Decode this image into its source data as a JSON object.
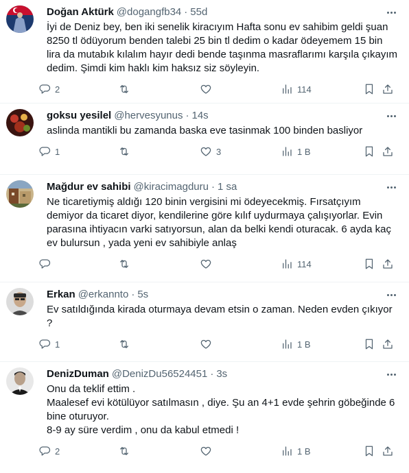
{
  "tweets": [
    {
      "name": "Doğan Aktürk",
      "handle": "@dogangfb34",
      "time": "55d",
      "text": "İyi de Deniz bey, ben iki senelik kiracıyım Hafta sonu ev sahibim geldi şuan 8250 tl ödüyorum benden talebi 25 bin tl dedim o kadar ödeyemem 15 bin lira da mutabık kılalım hayır dedi bende taşınma masraflarımı karşıla çıkayım dedim. Şimdi kim haklı kim haksız siz söyleyin.",
      "replies": "2",
      "retweets": "",
      "likes": "",
      "views": "114",
      "avatar_color": "#1d3a6e"
    },
    {
      "name": "goksu yesilel",
      "handle": "@hervesyunus",
      "time": "14s",
      "text": "aslinda mantikli bu zamanda baska eve tasinmak 100 binden basliyor",
      "replies": "1",
      "retweets": "",
      "likes": "3",
      "views": "1 B",
      "avatar_color": "#8a2a1c"
    },
    {
      "name": "Mağdur ev sahibi",
      "handle": "@kiracimagduru",
      "time": "1 sa",
      "text": "Ne ticaretiymiş aldığı 120 binin vergisini mi ödeyecekmiş. Fırsatçıyım demiyor da ticaret diyor, kendilerine göre kılıf uydurmaya çalışıyorlar. Evin parasına ihtiyacın varki satıyorsun, alan da belki kendi oturacak. 6 ayda kaç ev bulursun , yada yeni ev sahibiyle anlaş",
      "replies": "",
      "retweets": "",
      "likes": "",
      "views": "114",
      "avatar_color": "#6e5a3a"
    },
    {
      "name": "Erkan",
      "handle": "@erkannto",
      "time": "5s",
      "text": "Ev satıldığında kirada oturmaya devam etsin o zaman. Neden evden çıkıyor ?",
      "replies": "1",
      "retweets": "",
      "likes": "",
      "views": "1 B",
      "avatar_color": "#9a9a9a"
    },
    {
      "name": "DenizDuman",
      "handle": "@DenizDu56524451",
      "time": "3s",
      "text": "Onu da teklif ettim .\nMaalesef evi kötülüyor satılmasın , diye. Şu an 4+1 evde şehrin göbeğinde 6 bine oturuyor.\n8-9 ay süre verdim , onu da kabul etmedi !",
      "replies": "2",
      "retweets": "",
      "likes": "",
      "views": "1 B",
      "avatar_color": "#3a3a3a"
    }
  ],
  "icons": [
    "reply-icon",
    "retweet-icon",
    "like-icon",
    "views-icon",
    "bookmark-icon",
    "share-icon",
    "more-icon"
  ]
}
